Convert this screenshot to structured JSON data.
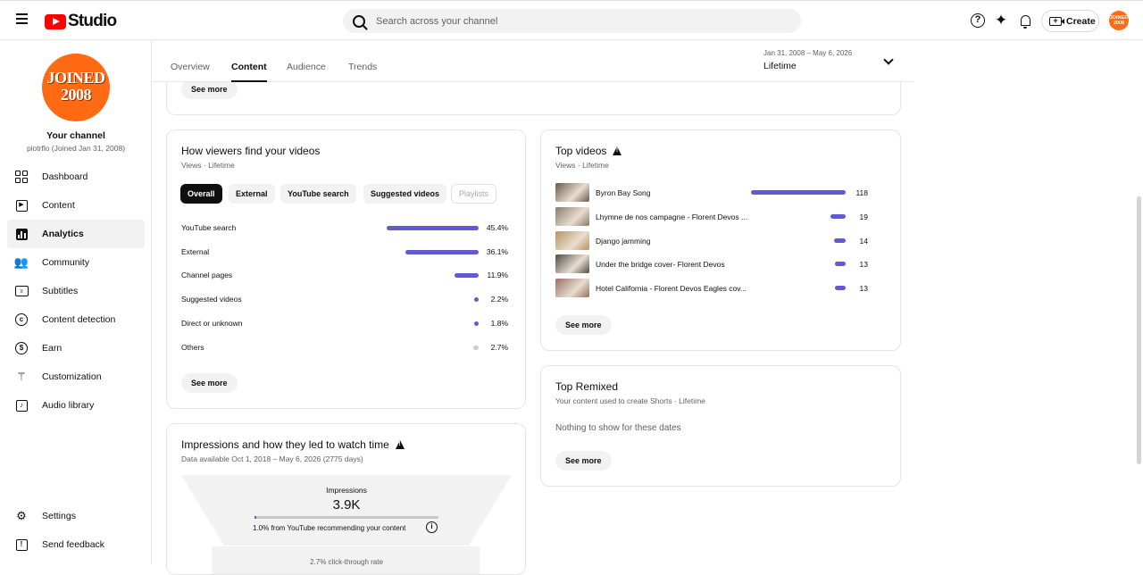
{
  "app": {
    "brand": "Studio"
  },
  "search": {
    "placeholder": "Search across your channel"
  },
  "header": {
    "create_label": "Create",
    "avatar_text": "JOINED 2008"
  },
  "channel": {
    "avatar_line1": "JOINED",
    "avatar_line2": "2008",
    "name": "Your channel",
    "subtitle": "piotrflo (Joined Jan 31, 2008)"
  },
  "sidebar": {
    "items": [
      {
        "label": "Dashboard",
        "icon": "dashboard-icon"
      },
      {
        "label": "Content",
        "icon": "content-icon"
      },
      {
        "label": "Analytics",
        "icon": "analytics-icon"
      },
      {
        "label": "Community",
        "icon": "community-icon"
      },
      {
        "label": "Subtitles",
        "icon": "subtitles-icon"
      },
      {
        "label": "Content detection",
        "icon": "copyright-icon"
      },
      {
        "label": "Earn",
        "icon": "dollar-icon"
      },
      {
        "label": "Customization",
        "icon": "magic-wand-icon"
      },
      {
        "label": "Audio library",
        "icon": "audio-library-icon"
      }
    ],
    "settings": "Settings",
    "feedback": "Send feedback"
  },
  "tabs": [
    "Overview",
    "Content",
    "Audience",
    "Trends"
  ],
  "date_range": {
    "range": "Jan 31, 2008 – May 6, 2026",
    "label": "Lifetime"
  },
  "top_card": {
    "see_more": "See more"
  },
  "viewers_card": {
    "title": "How viewers find your videos",
    "subtitle": "Views · Lifetime",
    "filters": [
      "Overall",
      "External",
      "YouTube search",
      "Suggested videos",
      "Playlists"
    ],
    "rows": [
      {
        "label": "YouTube search",
        "value": "45.4%",
        "pct": 45.4
      },
      {
        "label": "External",
        "value": "36.1%",
        "pct": 36.1
      },
      {
        "label": "Channel pages",
        "value": "11.9%",
        "pct": 11.9
      },
      {
        "label": "Suggested videos",
        "value": "2.2%",
        "pct": 2.2
      },
      {
        "label": "Direct or unknown",
        "value": "1.8%",
        "pct": 1.8
      },
      {
        "label": "Others",
        "value": "2.7%",
        "pct": 2.7
      }
    ],
    "see_more": "See more"
  },
  "impressions_card": {
    "title": "Impressions and how they led to watch time",
    "subtitle": "Data available Oct 1, 2018 – May 6, 2026 (2775 days)",
    "impressions_label": "Impressions",
    "impressions_value": "3.9K",
    "recommending_text": "1.0% from YouTube recommending your content",
    "ctr_text": "2.7% click-through rate"
  },
  "top_videos": {
    "title": "Top videos",
    "subtitle": "Views · Lifetime",
    "videos": [
      {
        "title": "Byron Bay Song",
        "views": "118",
        "value": 118
      },
      {
        "title": "Lhymne de nos campagne - Florent Devos ...",
        "views": "19",
        "value": 19
      },
      {
        "title": "Django jamming",
        "views": "14",
        "value": 14
      },
      {
        "title": "Under the bridge cover- Florent Devos",
        "views": "13",
        "value": 13
      },
      {
        "title": "Hotel California - Florent Devos Eagles cov...",
        "views": "13",
        "value": 13
      }
    ],
    "see_more": "See more"
  },
  "top_remixed": {
    "title": "Top Remixed",
    "subtitle": "Your content used to create Shorts · Lifetime",
    "empty": "Nothing to show for these dates",
    "see_more": "See more"
  },
  "colors": {
    "accent": "#5f5bd3",
    "brand": "#ff0000",
    "avatar": "#ff6a13"
  }
}
